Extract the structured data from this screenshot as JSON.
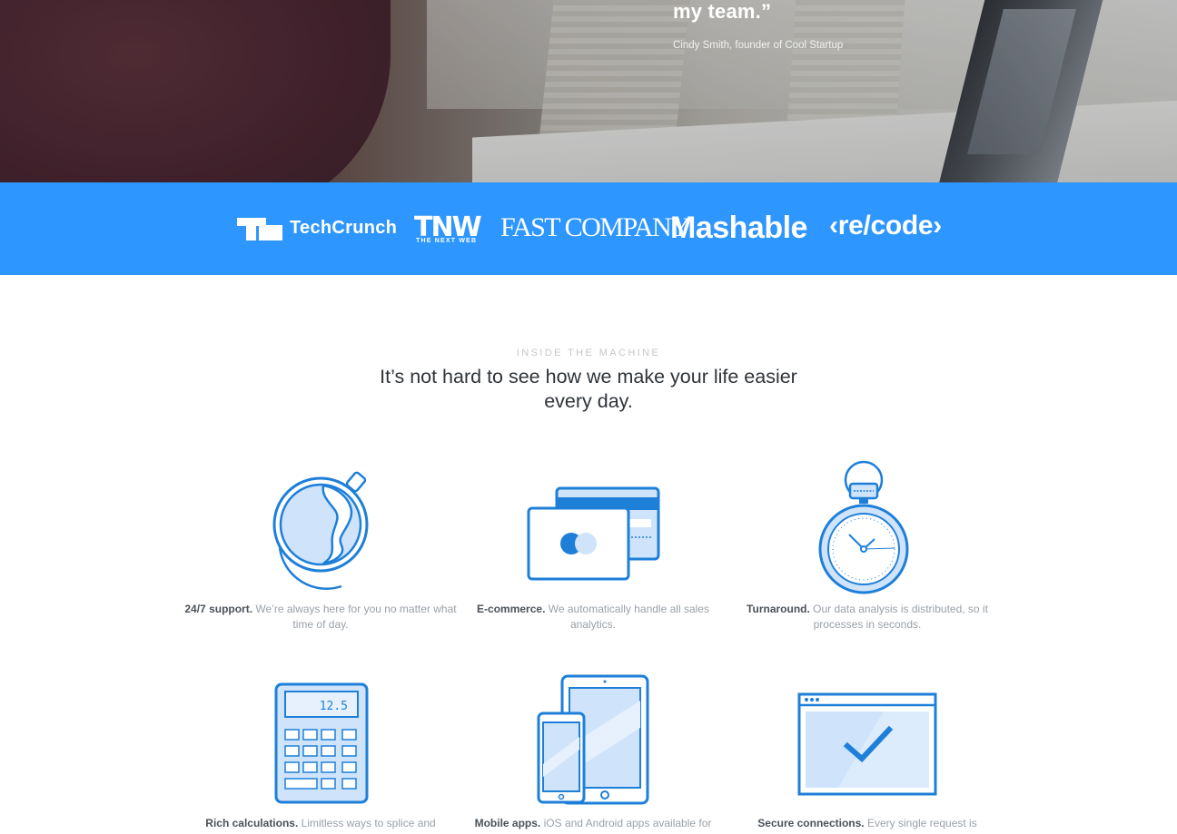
{
  "hero": {
    "quote_tail": "my team.”",
    "author": "Cindy Smith, founder of Cool Startup"
  },
  "press": {
    "brand_color": "#2d96ff",
    "logos": [
      {
        "name": "TechCrunch",
        "text": "TechCrunch"
      },
      {
        "name": "TNW",
        "text": "TNW",
        "sub": "THE NEXT WEB"
      },
      {
        "name": "Fast Company",
        "text": "FAST COMPANY"
      },
      {
        "name": "Mashable",
        "text": "Mashable"
      },
      {
        "name": "Recode",
        "text": "‹re/code›"
      }
    ]
  },
  "section": {
    "kicker": "INSIDE THE MACHINE",
    "headline": "It’s not hard to see how we make your life easier every day."
  },
  "features": [
    {
      "icon": "globe-icon",
      "title": "24/7 support.",
      "text": "We’re always here for you no matter what time of day."
    },
    {
      "icon": "credit-cards-icon",
      "title": "E-commerce.",
      "text": "We automatically handle all sales analytics."
    },
    {
      "icon": "stopwatch-icon",
      "title": "Turnaround.",
      "text": "Our data analysis is distributed, so it processes in seconds."
    },
    {
      "icon": "calculator-icon",
      "title": "Rich calculations.",
      "text": "Limitless ways to splice and",
      "display": "12.5"
    },
    {
      "icon": "devices-icon",
      "title": "Mobile apps.",
      "text": "iOS and Android apps available for"
    },
    {
      "icon": "secure-window-icon",
      "title": "Secure connections.",
      "text": "Every single request is"
    }
  ],
  "colors": {
    "icon_stroke": "#1e7fd9",
    "icon_fill": "#cfe4fb",
    "icon_fill_light": "#e6f1fd"
  }
}
